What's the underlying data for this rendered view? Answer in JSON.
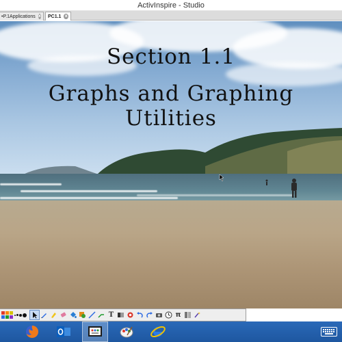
{
  "window": {
    "title": "ActivInspire - Studio"
  },
  "tabs": [
    {
      "label": "•P.1Applications",
      "close_glyph": "x"
    },
    {
      "label": "PC1.1",
      "close_glyph": "x"
    }
  ],
  "slide": {
    "title_line1": "Section 1.1",
    "title_line2": "Graphs and Graphing Utilities"
  },
  "toolbar": {
    "text_tool": "T",
    "pi_tool": "π",
    "colors": [
      "#e03a2a",
      "#ff8800",
      "#d6c200",
      "#2d6be3",
      "#1f9c2f",
      "#8b2fc9",
      "#ffffff",
      "#777777",
      "#000000"
    ],
    "icons": [
      "select-icon",
      "pen-icon",
      "highlighter-icon",
      "eraser-icon",
      "fill-icon",
      "shape-icon",
      "line-icon",
      "text-icon",
      "revealer-icon",
      "undo-icon",
      "redo-icon",
      "camera-icon",
      "clock-icon",
      "pi-icon",
      "dual-user-icon",
      "magic-ink-icon"
    ]
  },
  "taskbar": {
    "apps": [
      "firefox-icon",
      "outlook-icon",
      "activinspire-icon",
      "paint-icon",
      "internet-explorer-icon"
    ],
    "accent": "#1e57a0"
  }
}
